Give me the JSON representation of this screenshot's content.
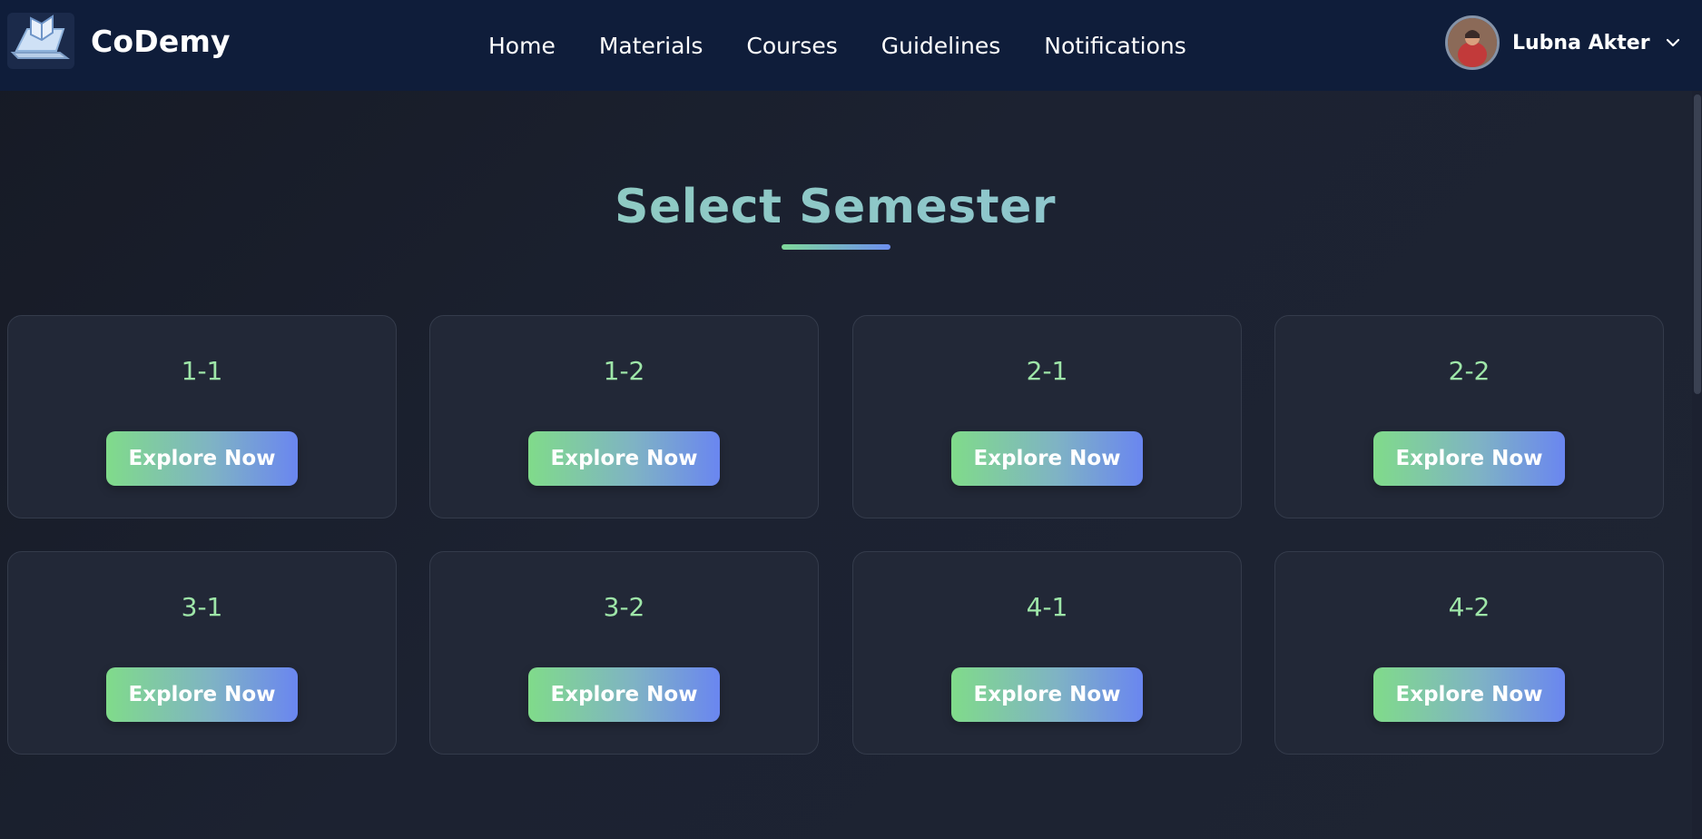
{
  "header": {
    "brand": "CoDemy",
    "nav": [
      "Home",
      "Materials",
      "Courses",
      "Guidelines",
      "Notifications"
    ],
    "user_name": "Lubna Akter"
  },
  "main": {
    "title": "Select Semester",
    "semesters": [
      {
        "name": "1-1",
        "button": "Explore Now"
      },
      {
        "name": "1-2",
        "button": "Explore Now"
      },
      {
        "name": "2-1",
        "button": "Explore Now"
      },
      {
        "name": "2-2",
        "button": "Explore Now"
      },
      {
        "name": "3-1",
        "button": "Explore Now"
      },
      {
        "name": "3-2",
        "button": "Explore Now"
      },
      {
        "name": "4-1",
        "button": "Explore Now"
      },
      {
        "name": "4-2",
        "button": "Explore Now"
      }
    ]
  },
  "colors": {
    "nav_bg": "#0f1d3a",
    "card_bg": "#222837",
    "semester_text": "#9ee6a8",
    "button_gradient_start": "#80db8a",
    "button_gradient_end": "#6a86f0"
  },
  "icons": {
    "logo": "laptop-book-icon",
    "user_menu": "chevron-down-icon"
  }
}
